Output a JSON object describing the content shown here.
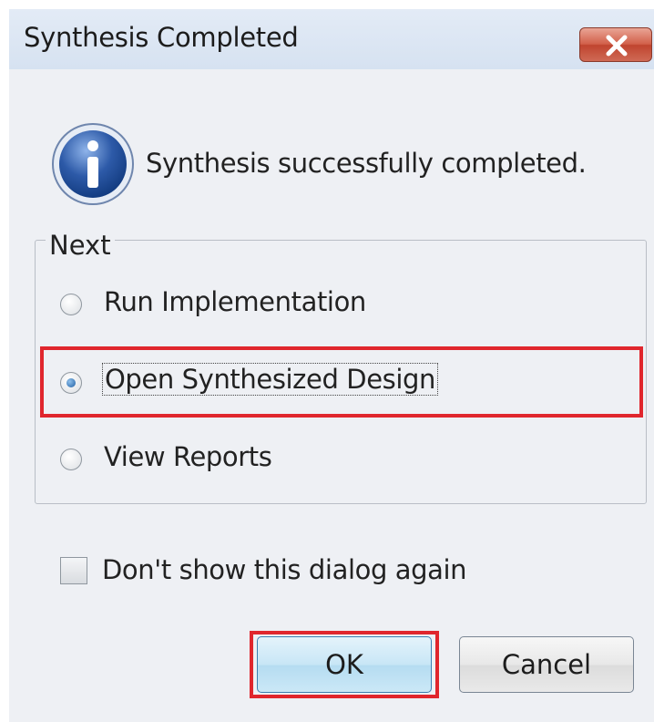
{
  "window": {
    "title": "Synthesis Completed",
    "close_icon": "close-icon"
  },
  "message": {
    "icon": "info-icon",
    "text": "Synthesis successfully completed."
  },
  "next_group": {
    "label": "Next",
    "options": [
      {
        "label": "Run Implementation",
        "selected": false
      },
      {
        "label": "Open Synthesized Design",
        "selected": true
      },
      {
        "label": "View Reports",
        "selected": false
      }
    ]
  },
  "dont_show_again": {
    "label": "Don't show this dialog again",
    "checked": false
  },
  "buttons": {
    "ok": "OK",
    "cancel": "Cancel"
  },
  "colors": {
    "highlight": "#e0262d",
    "close_button": "#c0442f",
    "info_icon": "#2d5aa8"
  }
}
